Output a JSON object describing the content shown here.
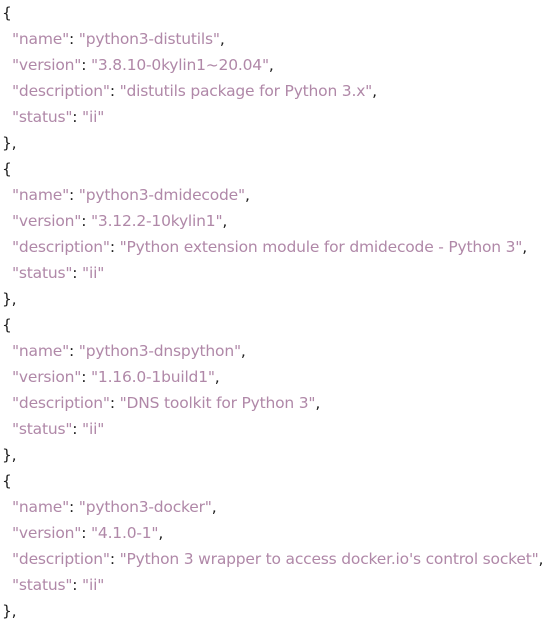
{
  "packages": [
    {
      "name": "python3-distutils",
      "version": "3.8.10-0kylin1~20.04",
      "description": "distutils package for Python 3.x",
      "status": "ii"
    },
    {
      "name": "python3-dmidecode",
      "version": "3.12.2-10kylin1",
      "description": "Python extension module for dmidecode - Python 3",
      "status": "ii"
    },
    {
      "name": "python3-dnspython",
      "version": "1.16.0-1build1",
      "description": "DNS toolkit for Python 3",
      "status": "ii"
    },
    {
      "name": "python3-docker",
      "version": "4.1.0-1",
      "description": "Python 3 wrapper to access docker.io's control socket",
      "status": "ii"
    }
  ],
  "syntax": {
    "key_name": "\"name\"",
    "key_version": "\"version\"",
    "key_description": "\"description\"",
    "key_status": "\"status\"",
    "open_brace": "{",
    "close_brace": "},",
    "colon": ": ",
    "comma": ","
  },
  "colors": {
    "key_string": "#b088a8",
    "punctuation": "#202020",
    "background": "#ffffff"
  }
}
